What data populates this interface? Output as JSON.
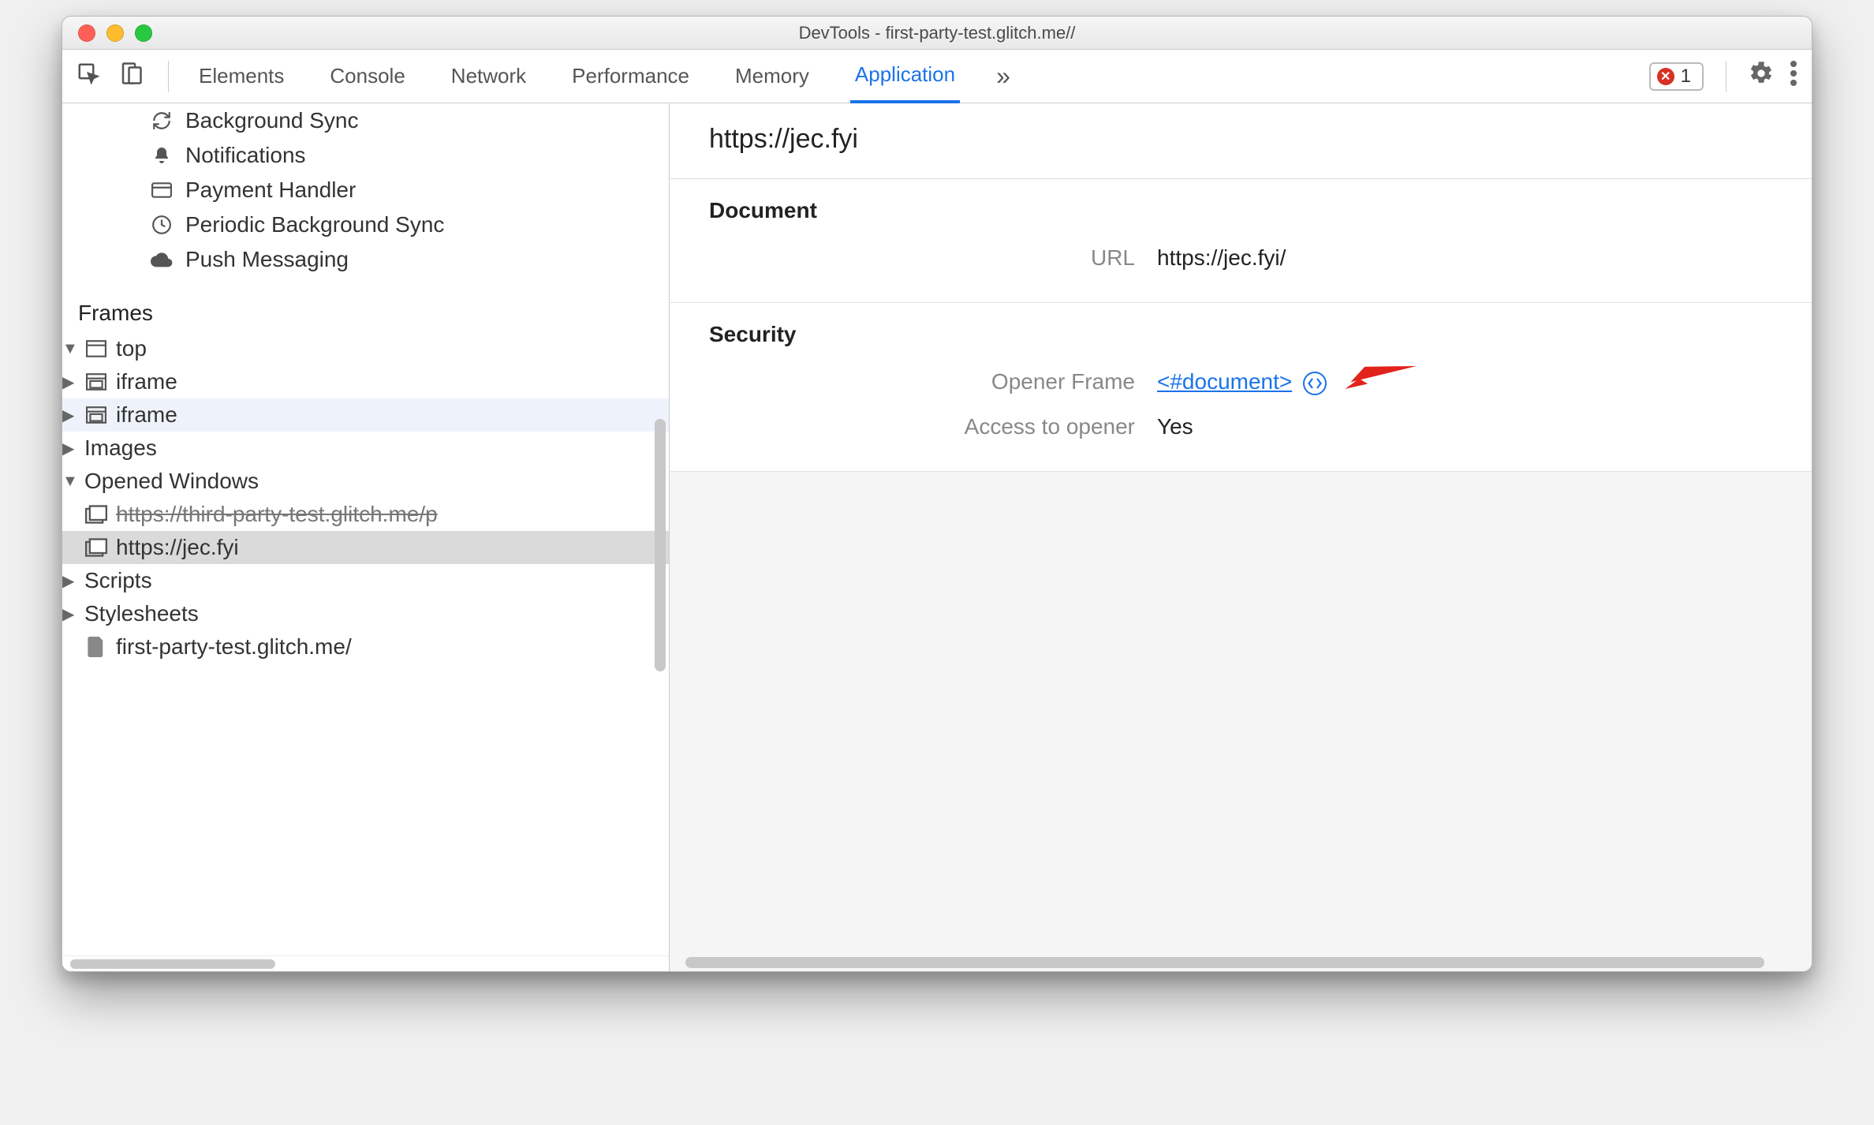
{
  "window": {
    "title": "DevTools - first-party-test.glitch.me//"
  },
  "toolbar": {
    "tabs": [
      "Elements",
      "Console",
      "Network",
      "Performance",
      "Memory",
      "Application"
    ],
    "active_tab": "Application",
    "errors": "1"
  },
  "sidebar": {
    "bg_items": [
      {
        "icon": "sync",
        "label": "Background Sync"
      },
      {
        "icon": "bell",
        "label": "Notifications"
      },
      {
        "icon": "card",
        "label": "Payment Handler"
      },
      {
        "icon": "clock",
        "label": "Periodic Background Sync"
      },
      {
        "icon": "cloud",
        "label": "Push Messaging"
      }
    ],
    "frames_label": "Frames",
    "tree": {
      "top": "top",
      "iframe1": "iframe",
      "iframe2": "iframe",
      "images": "Images",
      "opened": "Opened Windows",
      "win1": "https://third-party-test.glitch.me/p",
      "win2": "https://jec.fyi",
      "scripts": "Scripts",
      "stylesheets": "Stylesheets",
      "file": "first-party-test.glitch.me/"
    }
  },
  "main": {
    "header": "https://jec.fyi",
    "document": {
      "title": "Document",
      "url_label": "URL",
      "url_value": "https://jec.fyi/"
    },
    "security": {
      "title": "Security",
      "opener_label": "Opener Frame",
      "opener_value": "<#document>",
      "access_label": "Access to opener",
      "access_value": "Yes"
    }
  }
}
